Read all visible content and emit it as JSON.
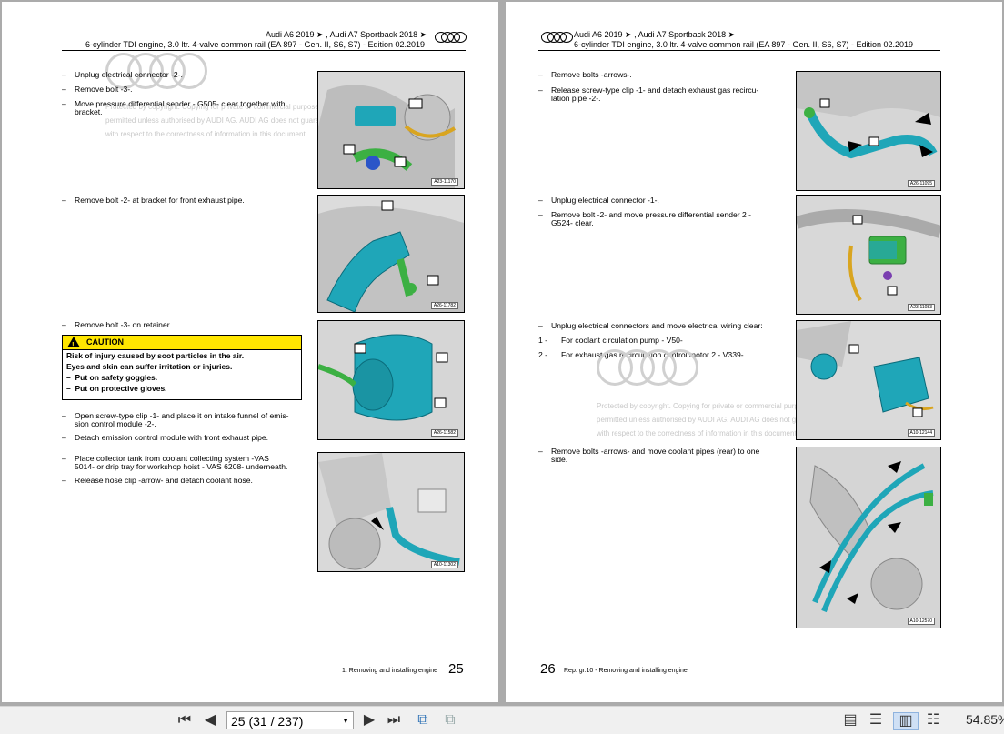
{
  "colors": {
    "caution": "#ffe600",
    "part_blue": "#1fa6b8",
    "part_green": "#3cb043"
  },
  "left_page": {
    "header_line1": "Audi A6 2019 ➤ , Audi A7 Sportback 2018 ➤",
    "header_line2": "6-cylinder TDI engine, 3.0 ltr. 4-valve common rail (EA 897 - Gen. II, S6, S7) - Edition 02.2019",
    "steps": [
      "Unplug electrical connector -2-.",
      "Remove bolt -3-.",
      "Move pressure differential sender - G505- clear together with bracket.",
      "Remove bolt -2- at bracket for front exhaust pipe.",
      "Remove bolt -3- on retainer.",
      "Open screw-type clip -1- and place it on intake funnel of emission control module -2-.",
      "Detach emission control module with front exhaust pipe.",
      "Place collector tank from coolant collecting system -VAS 5014- or drip tray for workshop hoist - VAS 6208- underneath.",
      "Release hose clip -arrow- and detach coolant hose."
    ],
    "step3_l2": "bracket.",
    "step6_l1": "Open screw-type clip -1- and place it on intake funnel of emis-",
    "step6_l2": "sion control module -2-.",
    "step8_l1": "Place collector tank from coolant collecting system -VAS",
    "step8_l2": "5014- or drip tray for workshop hoist - VAS 6208- underneath.",
    "step3_l1": "Move pressure differential sender - G505- clear together with",
    "caution": {
      "title": "CAUTION",
      "line1": "Risk of injury caused by soot particles in the air.",
      "line2": "Eyes and skin can suffer irritation or injuries.",
      "item1": "Put on safety goggles.",
      "item2": "Put on protective gloves."
    },
    "figures": [
      "A23-11170",
      "A26-11782",
      "A26-11582",
      "A10-11302"
    ],
    "footer_text": "1. Removing and installing engine",
    "page_number": "25",
    "watermark": {
      "line1": "Protected by copyright. Copying for private or commercial purposes, in part or in whole, is not",
      "line2": "permitted unless authorised by AUDI AG. AUDI AG does not guarantee or accept any liability",
      "line3": "with respect to the correctness of information in this document."
    }
  },
  "right_page": {
    "header_line1": "Audi A6 2019 ➤ , Audi A7 Sportback 2018 ➤",
    "header_line2": "6-cylinder TDI engine, 3.0 ltr. 4-valve common rail (EA 897 - Gen. II, S6, S7) - Edition 02.2019",
    "s1": "Remove bolts -arrows-.",
    "s2_l1": "Release screw-type clip -1- and detach exhaust gas recircu-",
    "s2_l2": "lation pipe -2-.",
    "s3": "Unplug electrical connector -1-.",
    "s4_l1": "Remove bolt -2- and move pressure differential sender 2 -",
    "s4_l2": "G524- clear.",
    "s5": "Unplug electrical connectors and move electrical wiring clear:",
    "n1_label": "1 -",
    "n1_text": "For coolant circulation pump - V50-",
    "n2_label": "2 -",
    "n2_text": "For exhaust gas recirculation control motor 2 - V339-",
    "s6_l1": "Remove bolts -arrows- and move coolant pipes (rear) to one",
    "s6_l2": "side.",
    "figures": [
      "A26-11095",
      "A23-11083",
      "A10-12144",
      "A10-12570"
    ],
    "page_number": "26",
    "footer_text": "Rep. gr.10 - Removing and installing engine",
    "watermark": {
      "line1": "Protected by copyright. Copying for private or commercial purposes, in part or in whole, is not",
      "line2": "permitted unless authorised by AUDI AG. AUDI AG does not guarantee or accept any liability",
      "line3": "with respect to the correctness of information in this document."
    }
  },
  "toolbar": {
    "page_field": "25 (31 / 237)",
    "zoom": "54.85%"
  },
  "dash": "–"
}
